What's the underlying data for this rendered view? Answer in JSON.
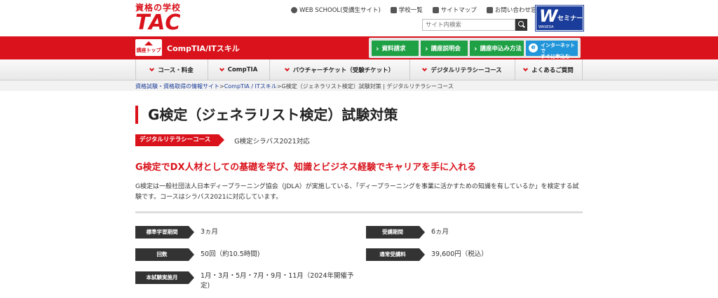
{
  "header": {
    "logo_top": "資格の学校",
    "logo_main": "TAC",
    "utility_links": [
      {
        "label": "WEB SCHOOL(受講生サイト)",
        "icon": "gear-icon"
      },
      {
        "label": "学校一覧",
        "icon": "building-icon"
      },
      {
        "label": "サイトマップ",
        "icon": "sitemap-icon"
      },
      {
        "label": "お問い合わせ窓口",
        "icon": "mail-icon"
      }
    ],
    "search_placeholder": "サイト内検索",
    "banner": {
      "mark": "W",
      "text": "セミナー",
      "sub": "WASEDA"
    }
  },
  "redbar": {
    "home_label": "講座トップ",
    "section": "CompTIA/ITスキル",
    "actions": [
      "資料請求",
      "講座説明会",
      "講座申込み方法"
    ],
    "internet_apply": [
      "インターネットで",
      "すぐに申込む"
    ]
  },
  "nav": {
    "items": [
      "コース・料金",
      "CompTIA",
      "バウチャーチケット（受験チケット）",
      "デジタルリテラシーコース",
      "よくあるご質問"
    ]
  },
  "breadcrumb": {
    "parts": [
      "資格試験・資格取得の情報サイト",
      "CompTIA / ITスキル"
    ],
    "current": "G検定（ジェネラリスト検定）試験対策 | デジタルリテラシーコース",
    "sep": ">"
  },
  "page": {
    "title": "G検定（ジェネラリスト検定）試験対策",
    "tag": "デジタルリテラシーコース",
    "tag_note": "G検定シラバス2021対応",
    "lead": "G検定でDX人材としての基礎を学び、知識とビジネス経験でキャリアを手に入れる",
    "description": "G検定は一般社団法人日本ディープラーニング協会（JDLA）が実施している、「ディープラーニングを事業に活かすための知識を有しているか」を検定する試験です。コースはシラバス2021に対応しています。"
  },
  "info": {
    "study_period": {
      "label": "標準学習期間",
      "value": "3ヵ月"
    },
    "course_period": {
      "label": "受講期間",
      "value": "6ヵ月"
    },
    "sessions": {
      "label": "回数",
      "value": "50回（約10.5時間)"
    },
    "fee": {
      "label": "通常受講料",
      "value": "39,600円（税込）"
    },
    "exam_months": {
      "label": "本試験実施月",
      "value": "1月・3月・5月・7月・9月・11月（2024年開催予定)"
    }
  },
  "colors": {
    "brand_red": "#d9121b",
    "green": "#1ea045",
    "blue": "#2195d9",
    "navy": "#1a3c9a"
  }
}
